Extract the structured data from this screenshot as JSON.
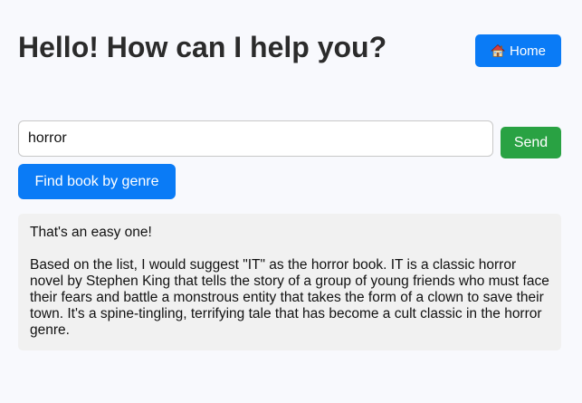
{
  "header": {
    "title": "Hello! How can I help you?",
    "home_button": {
      "label": "Home",
      "icon": "house-icon"
    }
  },
  "search": {
    "value": "horror",
    "send_label": "Send"
  },
  "actions": {
    "find_by_genre_label": "Find book by genre"
  },
  "response": {
    "intro": "That's an easy one!",
    "body": "Based on the list, I would suggest \"IT\" as the horror book. IT is a classic horror novel by Stephen King that tells the story of a group of young friends who must face their fears and battle a monstrous entity that takes the form of a clown to save their town. It's a spine-tingling, terrifying tale that has become a cult classic in the horror genre."
  },
  "colors": {
    "primary_button": "#0a7bf6",
    "send_button": "#29a243",
    "response_background": "#f1f1f1",
    "page_background": "#f8f9fd"
  }
}
